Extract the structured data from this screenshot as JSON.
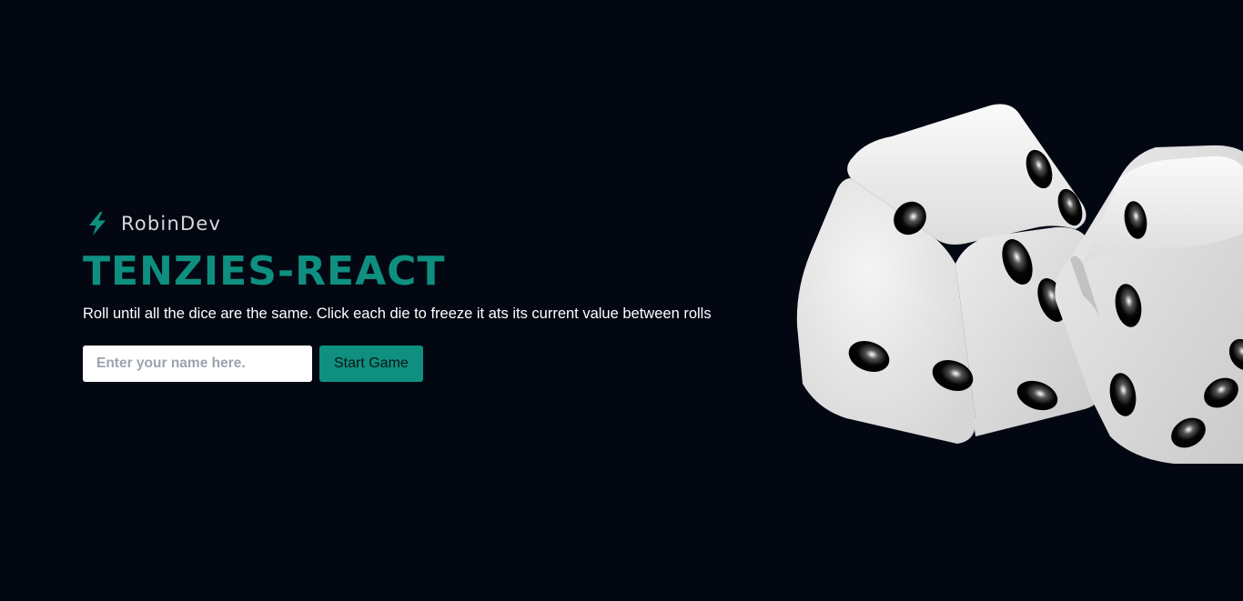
{
  "brand": {
    "icon": "bolt-icon",
    "name": "RobinDev"
  },
  "hero": {
    "title": "TENZIES-REACT",
    "subtitle": "Roll until all the dice are the same. Click each die to freeze it ats its current value between rolls"
  },
  "form": {
    "name_placeholder": "Enter your name here.",
    "name_value": "",
    "start_label": "Start Game"
  },
  "illustration": {
    "icon": "dice-illustration",
    "dice_count": 2
  },
  "colors": {
    "background": "#030712",
    "accent": "#0e8f80",
    "text": "#ffffff"
  }
}
